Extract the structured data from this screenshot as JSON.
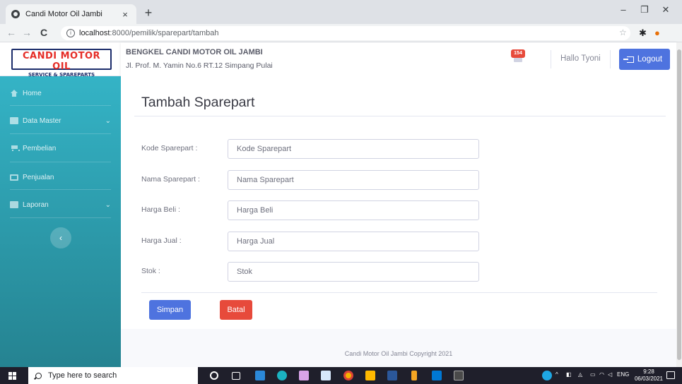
{
  "browser": {
    "tab_title": "Candi Motor Oil Jambi",
    "tab_close": "×",
    "new_tab": "+",
    "url_host": "localhost",
    "url_path": ":8000/pemilik/sparepart/tambah",
    "window_min": "–",
    "window_restore": "❐",
    "window_close": "✕"
  },
  "brand": {
    "logo_line1": "CANDI MOTOR OIL",
    "logo_line2": "SERVICE & SPAREPARTS"
  },
  "sidebar": {
    "items": [
      {
        "label": "Home",
        "icon": "home-icon"
      },
      {
        "label": "Data Master",
        "icon": "document-icon",
        "expandable": true
      },
      {
        "label": "Pembelian",
        "icon": "cart-icon"
      },
      {
        "label": "Penjualan",
        "icon": "money-icon"
      },
      {
        "label": "Laporan",
        "icon": "document-icon",
        "expandable": true
      }
    ],
    "toggle_label": "‹"
  },
  "topbar": {
    "shop_name": "BENGKEL CANDI MOTOR OIL JAMBI",
    "shop_address": "Jl. Prof. M. Yamin No.6 RT.12 Simpang Pulai",
    "notification_count": "154",
    "greeting": "Hallo Tyoni",
    "logout_label": "Logout"
  },
  "page": {
    "title": "Tambah Sparepart"
  },
  "form": {
    "fields": [
      {
        "label": "Kode Sparepart :",
        "placeholder": "Kode Sparepart",
        "value": ""
      },
      {
        "label": "Nama Sparepart :",
        "placeholder": "Nama Sparepart",
        "value": ""
      },
      {
        "label": "Harga Beli :",
        "placeholder": "Harga Beli",
        "value": ""
      },
      {
        "label": "Harga Jual :",
        "placeholder": "Harga Jual",
        "value": ""
      },
      {
        "label": "Stok :",
        "placeholder": "Stok",
        "value": ""
      }
    ],
    "save_label": "Simpan",
    "cancel_label": "Batal"
  },
  "footer": {
    "copyright": "Candi Motor Oil Jambi Copyright 2021"
  },
  "taskbar": {
    "search_placeholder": "Type here to search",
    "language": "ENG",
    "time": "9:28",
    "date": "06/03/2021"
  },
  "colors": {
    "sidebar_gradient_top": "#36b9cc",
    "sidebar_gradient_bottom": "#258391",
    "primary": "#4e73df",
    "danger": "#e74a3b"
  }
}
